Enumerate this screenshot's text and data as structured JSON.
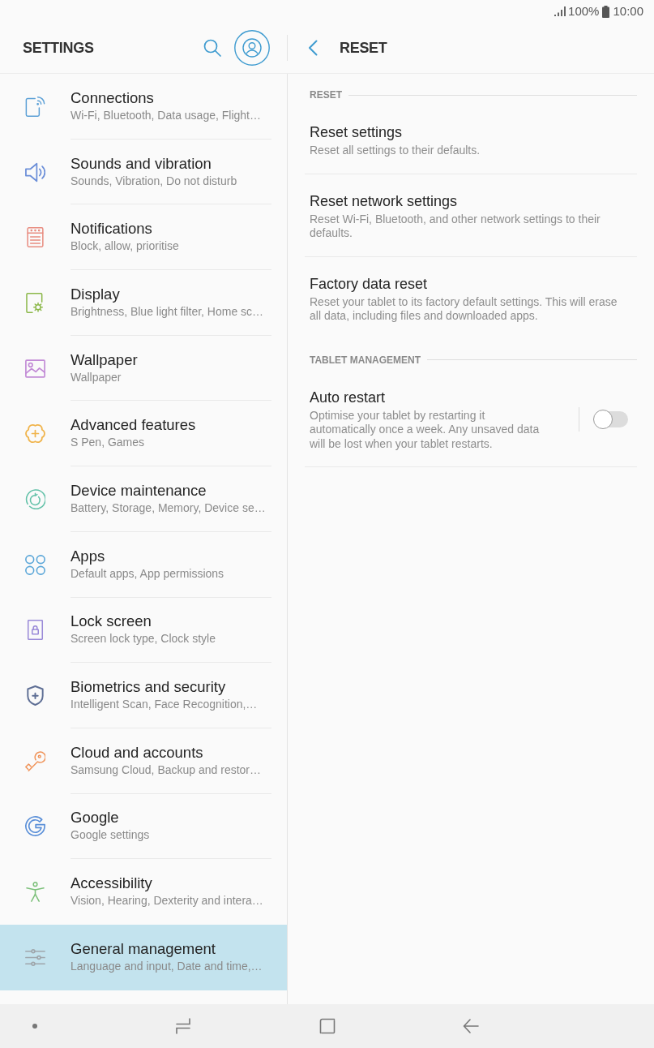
{
  "status_bar": {
    "battery_text": "100%",
    "time": "10:00"
  },
  "sidebar": {
    "title": "SETTINGS",
    "items": [
      {
        "title": "Connections",
        "subtitle": "Wi-Fi, Bluetooth, Data usage, Flight…",
        "color": "#5a9fd6",
        "selected": false
      },
      {
        "title": "Sounds and vibration",
        "subtitle": "Sounds, Vibration, Do not disturb",
        "color": "#6b8ed8",
        "selected": false
      },
      {
        "title": "Notifications",
        "subtitle": "Block, allow, prioritise",
        "color": "#e88c80",
        "selected": false
      },
      {
        "title": "Display",
        "subtitle": "Brightness, Blue light filter, Home sc…",
        "color": "#8cb84a",
        "selected": false
      },
      {
        "title": "Wallpaper",
        "subtitle": "Wallpaper",
        "color": "#c28bd6",
        "selected": false
      },
      {
        "title": "Advanced features",
        "subtitle": "S Pen, Games",
        "color": "#f0b44c",
        "selected": false
      },
      {
        "title": "Device maintenance",
        "subtitle": "Battery, Storage, Memory, Device se…",
        "color": "#62c1a8",
        "selected": false
      },
      {
        "title": "Apps",
        "subtitle": "Default apps, App permissions",
        "color": "#5aa6d8",
        "selected": false
      },
      {
        "title": "Lock screen",
        "subtitle": "Screen lock type, Clock style",
        "color": "#9a8ad8",
        "selected": false
      },
      {
        "title": "Biometrics and security",
        "subtitle": "Intelligent Scan, Face Recognition,…",
        "color": "#5f6f95",
        "selected": false
      },
      {
        "title": "Cloud and accounts",
        "subtitle": "Samsung Cloud, Backup and restor…",
        "color": "#f0945a",
        "selected": false
      },
      {
        "title": "Google",
        "subtitle": "Google settings",
        "color": "#5a8fd8",
        "selected": false
      },
      {
        "title": "Accessibility",
        "subtitle": "Vision, Hearing, Dexterity and intera…",
        "color": "#7cc07a",
        "selected": false
      },
      {
        "title": "General management",
        "subtitle": "Language and input, Date and time,…",
        "color": "#9fa6ab",
        "selected": true
      }
    ]
  },
  "detail": {
    "title": "RESET",
    "sections": [
      {
        "header": "RESET",
        "items": [
          {
            "kind": "link",
            "title": "Reset settings",
            "description": "Reset all settings to their defaults."
          },
          {
            "kind": "link",
            "title": "Reset network settings",
            "description": "Reset Wi-Fi, Bluetooth, and other network settings to their defaults."
          },
          {
            "kind": "link",
            "title": "Factory data reset",
            "description": "Reset your tablet to its factory default settings. This will erase all data, including files and downloaded apps."
          }
        ]
      },
      {
        "header": "TABLET MANAGEMENT",
        "items": [
          {
            "kind": "switch",
            "title": "Auto restart",
            "description": "Optimise your tablet by restarting it automatically once a week. Any unsaved data will be lost when your tablet restarts.",
            "on": false
          }
        ]
      }
    ]
  }
}
